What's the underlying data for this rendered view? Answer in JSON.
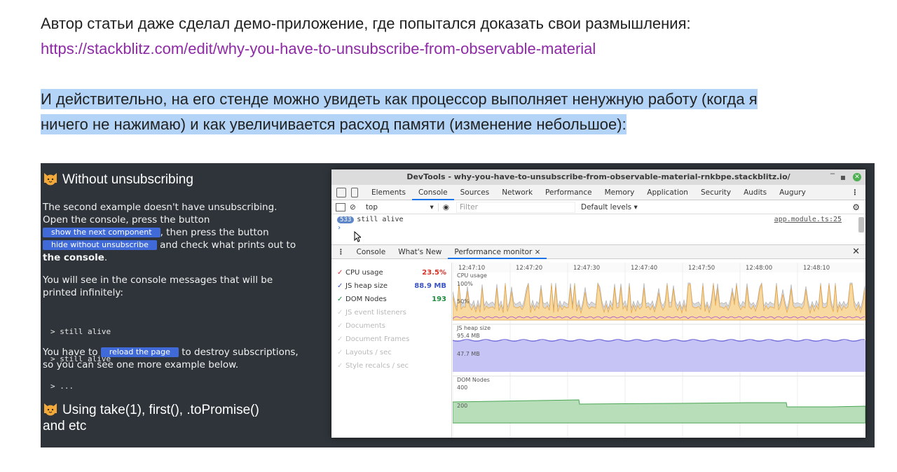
{
  "article": {
    "p1_text": "Автор статьи даже сделал демо-приложение, где попытался доказать свои размышления:",
    "p1_link": "https://stackblitz.com/edit/why-you-have-to-unsubscribe-from-observable-material",
    "p2_line1": "И действительно, на его стенде можно увидеть как процессор выполняет ненужную работу (когда я",
    "p2_line2": "ничего не нажимаю) и как увеличивается расход памяти (изменение небольшое):",
    "link_color": "#8e2aa6",
    "highlight_color": "#b3d4f7"
  },
  "demo": {
    "heading1": "Without unsubscribing",
    "para1_a": "The second example doesn't have unsubscribing.",
    "para1_b": "Open the console, press the button",
    "btn_show": "show the next component",
    "para1_c": ", then press the button",
    "btn_hide": "hide without unsubscribe",
    "para1_d": " and check what prints out to",
    "para1_e": "the console",
    "para1_f": ".",
    "para2_a": "You will see in the console messages that will be",
    "para2_b": "printed infinitely:",
    "code_lines": [
      "> still alive",
      "> still alive",
      "> ..."
    ],
    "para3_a": "You have to ",
    "btn_reload": "reload the page",
    "para3_b": " to destroy subscriptions,",
    "para3_c": "so you can see one more example below.",
    "heading2_a": "Using take(1), first(), .toPromise()",
    "heading2_b": "and etc",
    "icon": "cat-emoji-icon"
  },
  "devtools": {
    "title": "DevTools - why-you-have-to-unsubscribe-from-observable-material-rnkbpe.stackblitz.io/",
    "tabs": [
      "Elements",
      "Console",
      "Sources",
      "Network",
      "Performance",
      "Memory",
      "Application",
      "Security",
      "Audits",
      "Augury"
    ],
    "active_tab": "Console",
    "context": "top",
    "filter_placeholder": "Filter",
    "levels": "Default levels ▾",
    "console_count": "533",
    "console_msg": "still alive",
    "console_src": "app.module.ts:25",
    "drawer_tabs": [
      "Console",
      "What's New",
      "Performance monitor ×"
    ],
    "metrics": [
      {
        "name": "CPU usage",
        "value": "23.5%",
        "color": "#d93025",
        "on": true
      },
      {
        "name": "JS heap size",
        "value": "88.9 MB",
        "color": "#3b53c4",
        "on": true
      },
      {
        "name": "DOM Nodes",
        "value": "193",
        "color": "#1e8e3e",
        "on": true
      },
      {
        "name": "JS event listeners",
        "value": "",
        "color": "#b8b8b8",
        "on": false
      },
      {
        "name": "Documents",
        "value": "",
        "color": "#b8b8b8",
        "on": false
      },
      {
        "name": "Document Frames",
        "value": "",
        "color": "#b8b8b8",
        "on": false
      },
      {
        "name": "Layouts / sec",
        "value": "",
        "color": "#b8b8b8",
        "on": false
      },
      {
        "name": "Style recalcs / sec",
        "value": "",
        "color": "#b8b8b8",
        "on": false
      }
    ],
    "times": [
      "12:47:10",
      "12:47:20",
      "12:47:30",
      "12:47:40",
      "12:47:50",
      "12:48:00",
      "12:48:10"
    ],
    "cpu_label": "CPU usage",
    "cpu_100": "100%",
    "cpu_50": "50%",
    "heap_label": "JS heap size",
    "heap_max": "95.4 MB",
    "heap_mid": "47.7 MB",
    "dom_label": "DOM Nodes",
    "dom_max": "400",
    "dom_mid": "200"
  }
}
